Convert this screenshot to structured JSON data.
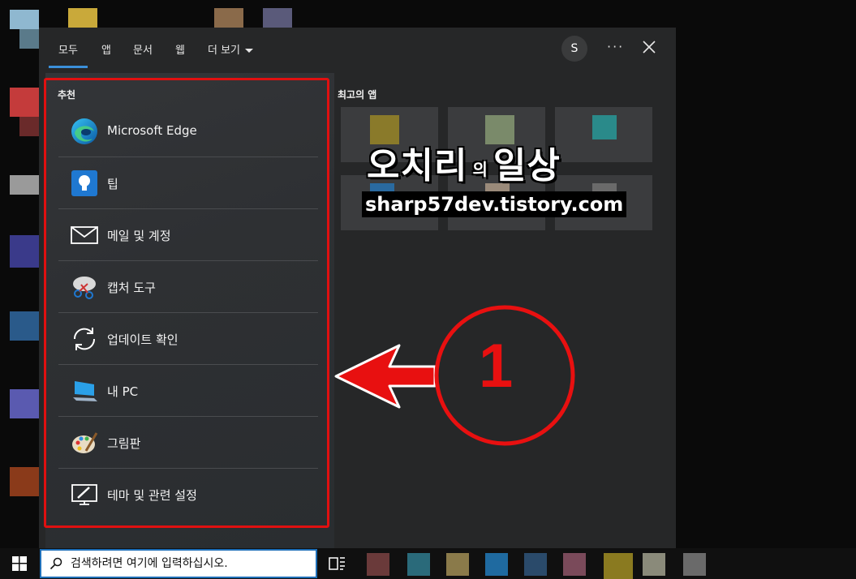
{
  "tabs": [
    {
      "label": "모두"
    },
    {
      "label": "앱"
    },
    {
      "label": "문서"
    },
    {
      "label": "웹"
    },
    {
      "label": "더 보기"
    }
  ],
  "header": {
    "avatar_initial": "S",
    "more_label": "···"
  },
  "recommend": {
    "title": "추천",
    "items": [
      {
        "label": "Microsoft Edge",
        "icon": "edge-icon"
      },
      {
        "label": "팁",
        "icon": "tips-icon"
      },
      {
        "label": "메일 및 계정",
        "icon": "mail-icon"
      },
      {
        "label": "캡처 도구",
        "icon": "snipping-tool-icon"
      },
      {
        "label": "업데이트 확인",
        "icon": "update-icon"
      },
      {
        "label": "내 PC",
        "icon": "pc-icon"
      },
      {
        "label": "그림판",
        "icon": "paint-icon"
      },
      {
        "label": "테마 및 관련 설정",
        "icon": "theme-settings-icon"
      }
    ]
  },
  "top_apps": {
    "title": "최고의 앱"
  },
  "watermark": {
    "line1_a": "오치리",
    "line1_b": "의",
    "line1_c": "일상",
    "line2": "sharp57dev.tistory.com"
  },
  "annotation": {
    "number": "1"
  },
  "taskbar": {
    "search_placeholder": "검색하려면 여기에 입력하십시오."
  },
  "colors": {
    "accent": "#3b8fd9",
    "highlight_red": "#e01010",
    "panel_bg": "#262728"
  }
}
